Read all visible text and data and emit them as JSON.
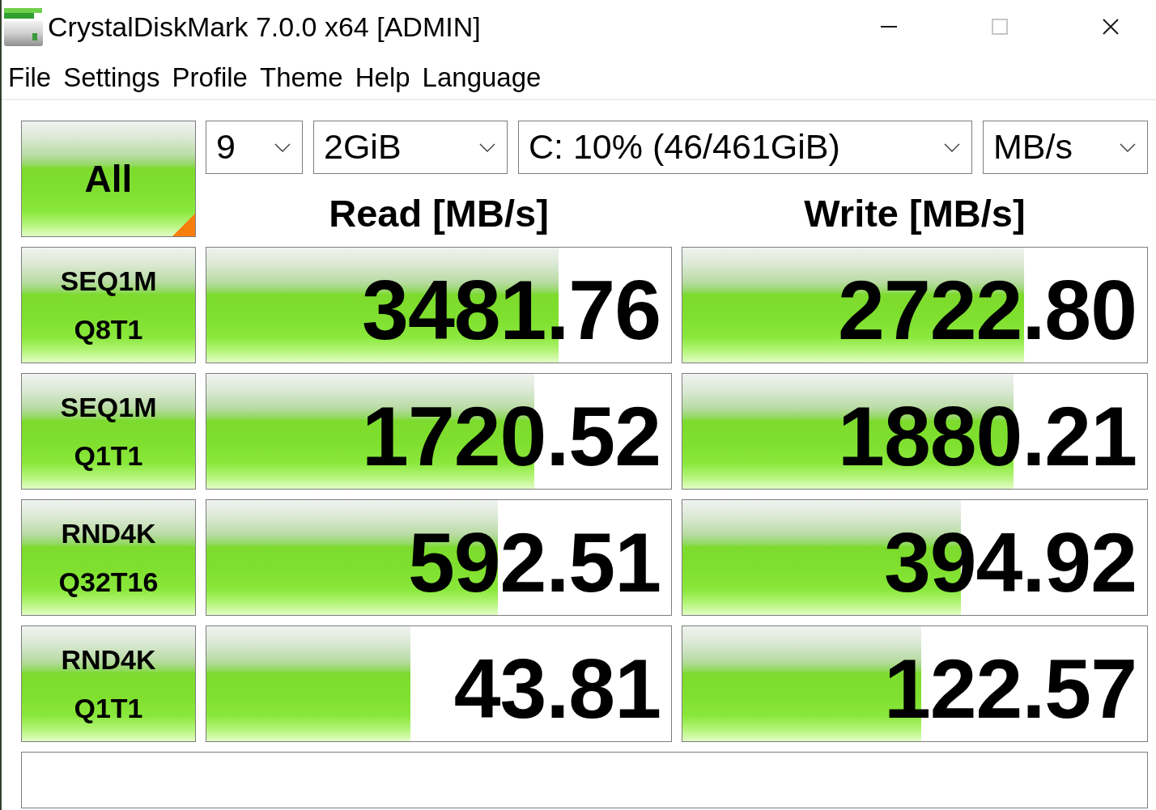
{
  "window": {
    "title": "CrystalDiskMark 7.0.0 x64 [ADMIN]",
    "controls": [
      {
        "kind": "minimize",
        "disabled": false
      },
      {
        "kind": "maximize",
        "disabled": true
      },
      {
        "kind": "close",
        "disabled": false
      }
    ]
  },
  "menu": [
    "File",
    "Settings",
    "Profile",
    "Theme",
    "Help",
    "Language"
  ],
  "all_button": {
    "label": "All"
  },
  "options": [
    {
      "value": "9"
    },
    {
      "value": "2GiB"
    },
    {
      "value": "C: 10% (46/461GiB)"
    },
    {
      "value": "MB/s"
    }
  ],
  "columns": [
    "Read [MB/s]",
    "Write [MB/s]"
  ],
  "tests": [
    {
      "name": "SEQ1M",
      "params": "Q8T1",
      "read": {
        "value": "3481.76",
        "level": 0.757
      },
      "write": {
        "value": "2722.80",
        "level": 0.736
      }
    },
    {
      "name": "SEQ1M",
      "params": "Q1T1",
      "read": {
        "value": "1720.52",
        "level": 0.705
      },
      "write": {
        "value": "1880.21",
        "level": 0.712
      }
    },
    {
      "name": "RND4K",
      "params": "Q32T16",
      "read": {
        "value": "592.51",
        "level": 0.628
      },
      "write": {
        "value": "394.92",
        "level": 0.599
      }
    },
    {
      "name": "RND4K",
      "params": "Q1T1",
      "read": {
        "value": "43.81",
        "level": 0.439
      },
      "write": {
        "value": "122.57",
        "level": 0.514
      }
    }
  ]
}
